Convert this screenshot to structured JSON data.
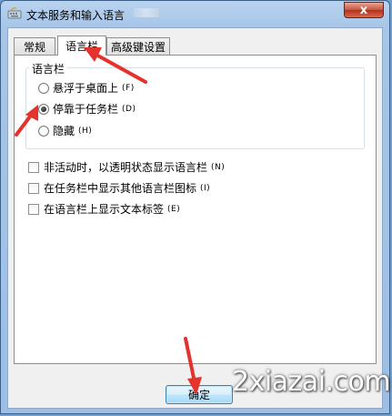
{
  "window": {
    "title": "文本服务和输入语言"
  },
  "tabs": [
    {
      "label": "常规",
      "active": false
    },
    {
      "label": "语言栏",
      "active": true
    },
    {
      "label": "高级键设置",
      "active": false
    }
  ],
  "language_bar_group": {
    "legend": "语言栏",
    "options": [
      {
        "label": "悬浮于桌面上",
        "hint": "(F)",
        "checked": false
      },
      {
        "label": "停靠于任务栏",
        "hint": "(D)",
        "checked": true
      },
      {
        "label": "隐藏",
        "hint": "(H)",
        "checked": false
      }
    ]
  },
  "checkboxes": [
    {
      "label": "非活动时，以透明状态显示语言栏",
      "hint": "(N)",
      "checked": false
    },
    {
      "label": "在任务栏中显示其他语言栏图标",
      "hint": "(I)",
      "checked": false
    },
    {
      "label": "在语言栏上显示文本标签",
      "hint": "(E)",
      "checked": false
    }
  ],
  "buttons": {
    "ok_label": "确定",
    "close_label": "x"
  },
  "watermark": "2xiazai.com",
  "colors": {
    "arrow": "#e5322d",
    "close": "#c7523c"
  }
}
